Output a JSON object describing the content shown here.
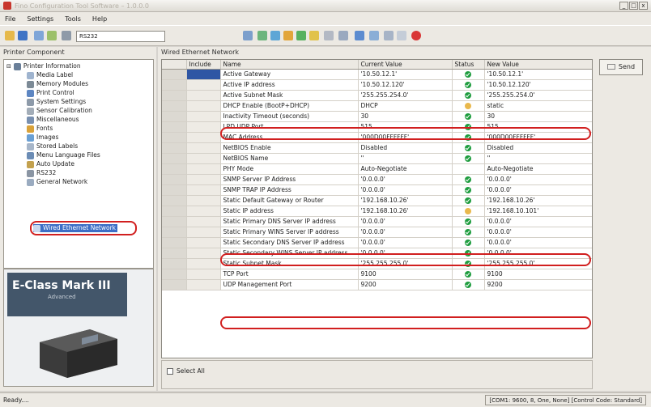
{
  "window": {
    "title": "Fino Configuration Tool Software – 1.0.0.0"
  },
  "menu": [
    "File",
    "Settings",
    "Tools",
    "Help"
  ],
  "toolbar": {
    "port": "RS232"
  },
  "left_pane": {
    "title": "Printer Component",
    "tree": [
      {
        "label": "Printer Information",
        "level": 0,
        "icon": "printer-icon"
      },
      {
        "label": "Media Label",
        "level": 1,
        "icon": "label-icon"
      },
      {
        "label": "Memory Modules",
        "level": 1,
        "icon": "memory-icon"
      },
      {
        "label": "Print Control",
        "level": 1,
        "icon": "print-control-icon"
      },
      {
        "label": "System Settings",
        "level": 1,
        "icon": "settings-icon"
      },
      {
        "label": "Sensor Calibration",
        "level": 1,
        "icon": "sensor-icon"
      },
      {
        "label": "Miscellaneous",
        "level": 1,
        "icon": "misc-icon"
      },
      {
        "label": "Fonts",
        "level": 1,
        "icon": "fonts-icon"
      },
      {
        "label": "Images",
        "level": 1,
        "icon": "images-icon"
      },
      {
        "label": "Stored Labels",
        "level": 1,
        "icon": "stored-labels-icon"
      },
      {
        "label": "Menu Language Files",
        "level": 1,
        "icon": "language-icon"
      },
      {
        "label": "Auto Update",
        "level": 1,
        "icon": "update-icon"
      },
      {
        "label": "RS232",
        "level": 1,
        "icon": "serial-icon"
      },
      {
        "label": "General Network",
        "level": 1,
        "icon": "network-icon"
      },
      {
        "label": "Wired Ethernet Network",
        "level": 1,
        "icon": "ethernet-icon",
        "selected": true
      }
    ],
    "promo": {
      "brand": "E-Class Mark III",
      "edition": "Advanced"
    }
  },
  "right_pane": {
    "title": "Wired Ethernet Network",
    "send_label": "Send",
    "select_all_label": "Select All",
    "columns": [
      "Include",
      "Name",
      "Current Value",
      "Status",
      "New Value"
    ],
    "rows": [
      {
        "name": "Active Gateway",
        "current": "'10.50.12.1'",
        "status": "ok",
        "new": "'10.50.12.1'",
        "include_active": true
      },
      {
        "name": "Active IP address",
        "current": "'10.50.12.120'",
        "status": "ok",
        "new": "'10.50.12.120'"
      },
      {
        "name": "Active Subnet Mask",
        "current": "'255.255.254.0'",
        "status": "ok",
        "new": "'255.255.254.0'"
      },
      {
        "name": "DHCP Enable (BootP+DHCP)",
        "current": "DHCP",
        "status": "warn",
        "new": "static"
      },
      {
        "name": "Inactivity Timeout (seconds)",
        "current": "30",
        "status": "ok",
        "new": "30"
      },
      {
        "name": "LPD UDP Port",
        "current": "515",
        "status": "ok",
        "new": "515"
      },
      {
        "name": "MAC Address",
        "current": "'000D00FFFFFF'",
        "status": "ok",
        "new": "'000D00FFFFFF'"
      },
      {
        "name": "NetBIOS Enable",
        "current": "Disabled",
        "status": "ok",
        "new": "Disabled"
      },
      {
        "name": "NetBIOS Name",
        "current": "''",
        "status": "ok",
        "new": "''"
      },
      {
        "name": "PHY Mode",
        "current": "Auto-Negotiate",
        "status": "",
        "new": "Auto-Negotiate"
      },
      {
        "name": "SNMP Server IP Address",
        "current": "'0.0.0.0'",
        "status": "ok",
        "new": "'0.0.0.0'"
      },
      {
        "name": "SNMP TRAP IP Address",
        "current": "'0.0.0.0'",
        "status": "ok",
        "new": "'0.0.0.0'"
      },
      {
        "name": "Static Default Gateway or Router",
        "current": "'192.168.10.26'",
        "status": "ok",
        "new": "'192.168.10.26'"
      },
      {
        "name": "Static IP address",
        "current": "'192.168.10.26'",
        "status": "warn",
        "new": "'192.168.10.101'"
      },
      {
        "name": "Static Primary DNS Server IP address",
        "current": "'0.0.0.0'",
        "status": "ok",
        "new": "'0.0.0.0'"
      },
      {
        "name": "Static Primary WINS Server IP address",
        "current": "'0.0.0.0'",
        "status": "ok",
        "new": "'0.0.0.0'"
      },
      {
        "name": "Static Secondary DNS Server IP address",
        "current": "'0.0.0.0'",
        "status": "ok",
        "new": "'0.0.0.0'"
      },
      {
        "name": "Static Secondary WINS Server IP address",
        "current": "'0.0.0.0'",
        "status": "ok",
        "new": "'0.0.0.0'"
      },
      {
        "name": "Static Subnet Mask",
        "current": "'255.255.255.0'",
        "status": "ok",
        "new": "'255.255.255.0'"
      },
      {
        "name": "TCP Port",
        "current": "9100",
        "status": "ok",
        "new": "9100"
      },
      {
        "name": "UDP Management Port",
        "current": "9200",
        "status": "ok",
        "new": "9200"
      }
    ]
  },
  "statusbar": {
    "left": "Ready....",
    "right": "[COM1: 9600, 8, One, None] [Control Code: Standard]"
  },
  "colors": {
    "highlight_oval": "#d11f1f",
    "selection": "#3d6ec6",
    "status_ok": "#1f9d3f"
  }
}
